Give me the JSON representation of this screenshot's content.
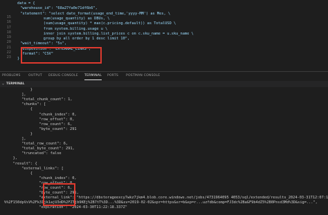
{
  "editor": {
    "line_numbers": [
      "15",
      "16",
      "17",
      "18",
      "19",
      "20",
      "21",
      "22",
      "23"
    ],
    "lines": [
      {
        "indent": 0,
        "text": "data = {"
      },
      {
        "indent": 1,
        "text": "\"warehouse_id\": \"68a27fa0e71df6b6\","
      },
      {
        "indent": 1,
        "text": "\"statement\": \"select date_format(usage_end_time,'yyyy-MM') as Mes, \\"
      },
      {
        "indent": 9,
        "text": "sum(usage_quantity) as DBUs, \\"
      },
      {
        "indent": 9,
        "text": "(sum(usage_quantity) * max(c.pricing.default)) as TotalUSD \\"
      },
      {
        "indent": 9,
        "text": "from system.billing.usage u \\"
      },
      {
        "indent": 9,
        "text": "inner join system.billing.list_prices c on c.sku_name = u.sku_name \\"
      },
      {
        "indent": 9,
        "text": "group by all order by 1 desc limit 10\","
      },
      {
        "indent": 1,
        "text": "\"wait_timeout\": \"5s\","
      },
      {
        "indent": 1,
        "text": "\"disposition\": \"EXTERNAL_LINKS\","
      },
      {
        "indent": 1,
        "text": "\"format\": \"CSV\""
      },
      {
        "indent": 0,
        "text": "}"
      }
    ]
  },
  "panel_tabs": [
    "PROBLEMS",
    "OUTPUT",
    "DEBUG CONSOLE",
    "TERMINAL",
    "PORTS",
    "POSTMAN CONSOLE"
  ],
  "active_tab": "TERMINAL",
  "terminal": {
    "header": "TERMINAL",
    "lines": [
      {
        "indent": 6,
        "text": "}"
      },
      {
        "indent": 4,
        "text": "],"
      },
      {
        "indent": 4,
        "text": "\"total_chunk_count\": 1,"
      },
      {
        "indent": 4,
        "text": "\"chunks\": ["
      },
      {
        "indent": 6,
        "text": "{"
      },
      {
        "indent": 8,
        "text": "\"chunk_index\": 0,"
      },
      {
        "indent": 8,
        "text": "\"row_offset\": 0,"
      },
      {
        "indent": 8,
        "text": "\"row_count\": 6,"
      },
      {
        "indent": 8,
        "text": "\"byte_count\": 291"
      },
      {
        "indent": 6,
        "text": "}"
      },
      {
        "indent": 4,
        "text": "],"
      },
      {
        "indent": 4,
        "text": "\"total_row_count\": 6,"
      },
      {
        "indent": 4,
        "text": "\"total_byte_count\": 291,"
      },
      {
        "indent": 4,
        "text": "\"truncated\": false"
      },
      {
        "indent": 2,
        "text": "},"
      },
      {
        "indent": 2,
        "text": "\"result\": {"
      },
      {
        "indent": 4,
        "text": "\"external_links\": ["
      },
      {
        "indent": 6,
        "text": "{"
      },
      {
        "indent": 8,
        "text": "\"chunk_index\": 0,"
      },
      {
        "indent": 8,
        "text": "\"row_offset\": 0,"
      },
      {
        "indent": 8,
        "text": "\"row_count\": 6,"
      },
      {
        "indent": 8,
        "text": "\"byte_count\": 291,"
      },
      {
        "indent": 8,
        "text": "\"external_link\": \"https://dbstorageexcy7wkz7jkm4.blob.core.windows.net/jobs/4731964095 4053/sql/extended/results_2024-03-31T12:07:17Z_a000"
      },
      {
        "indent": 0,
        "text": "%%2F150dpVsV%2Fk3Ijk1ajU3dD%2FZTjb9KEj%2B7tT%3D...%3D&sv=2019-02-02&spr=https&sr=b&sp=r...uzfdb&comp=FJ3dc%2BaGF9b4dZ5%2B0Pnsd3Md%3D&sig=...\","
      },
      {
        "indent": 8,
        "text": "\"expiration\": \"2024-03-30T11:22:18.337Z\""
      }
    ]
  }
}
